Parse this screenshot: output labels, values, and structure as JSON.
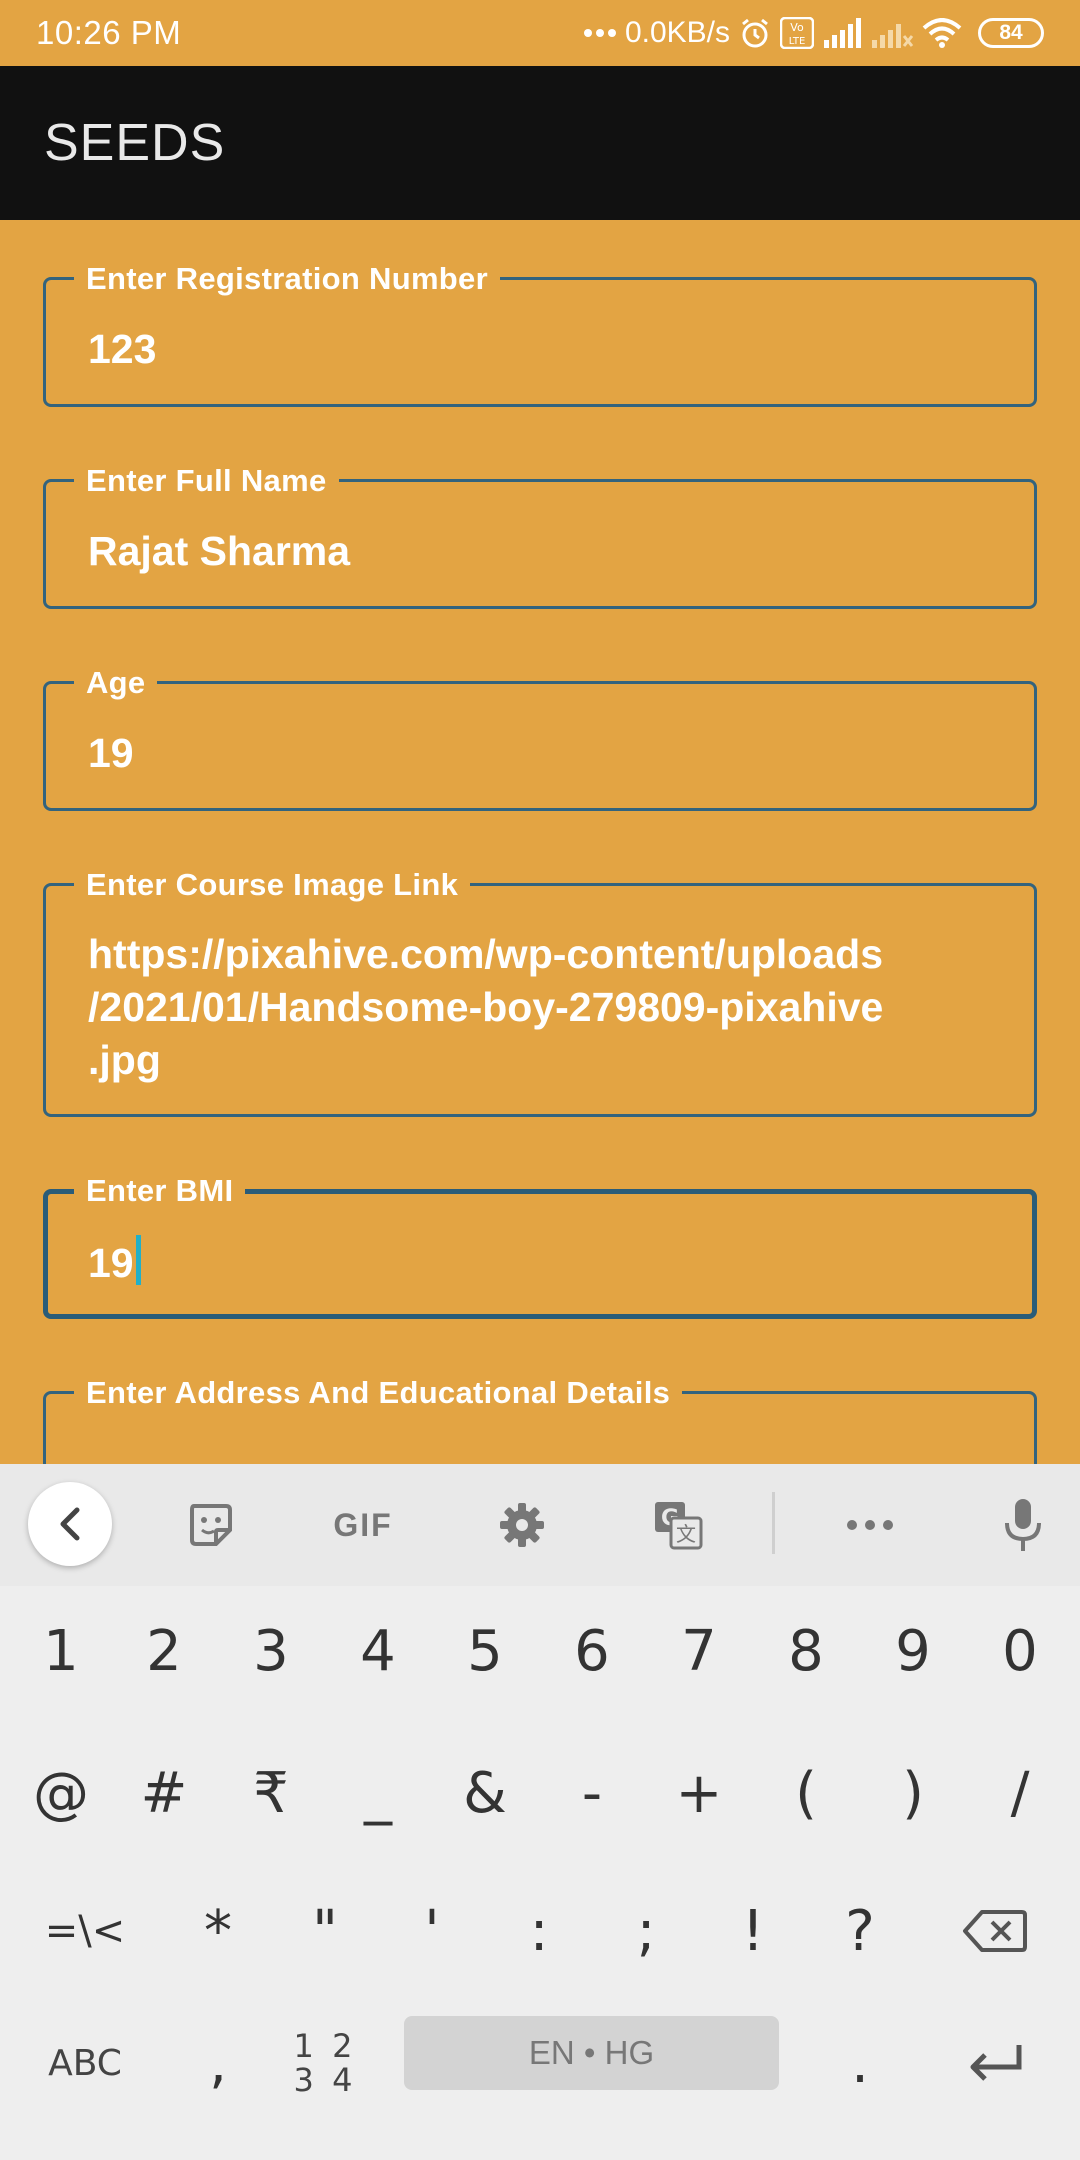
{
  "status_bar": {
    "time": "10:26 PM",
    "net_speed": "0.0KB/s",
    "battery": "84",
    "icons": [
      "dots-icon",
      "alarm-icon",
      "volte-icon",
      "signal-icon",
      "signal-weak-icon",
      "wifi-icon",
      "battery-icon"
    ]
  },
  "app_bar": {
    "title": "SEEDS"
  },
  "form": {
    "registration": {
      "label": "Enter Registration Number",
      "value": "123"
    },
    "full_name": {
      "label": "Enter Full Name",
      "value": "Rajat Sharma"
    },
    "age": {
      "label": "Age",
      "value": "19"
    },
    "course_image": {
      "label": "Enter Course Image Link",
      "value_lines": [
        "https://pixahive.com/wp-content/uploads",
        "/2021/01/Handsome-boy-279809-pixahive",
        ".jpg"
      ]
    },
    "bmi": {
      "label": "Enter BMI",
      "value": "19"
    },
    "address": {
      "label": "Enter Address And Educational Details",
      "value": ""
    }
  },
  "keyboard": {
    "toolbar": [
      "back-icon",
      "sticker-icon",
      "GIF",
      "settings-icon",
      "translate-icon",
      "more-icon",
      "mic-icon"
    ],
    "gif_label": "GIF",
    "row1": [
      "1",
      "2",
      "3",
      "4",
      "5",
      "6",
      "7",
      "8",
      "9",
      "0"
    ],
    "row2": [
      "@",
      "#",
      "₹",
      "_",
      "&",
      "-",
      "+",
      "(",
      ")",
      "/"
    ],
    "row3": [
      "=\\<",
      "*",
      "\"",
      "'",
      ":",
      ";",
      "!",
      "?"
    ],
    "row4": {
      "abc": "ABC",
      "comma": ",",
      "num_top": "1 2",
      "num_bottom": "3 4",
      "space": "EN • HG",
      "period": "."
    }
  }
}
